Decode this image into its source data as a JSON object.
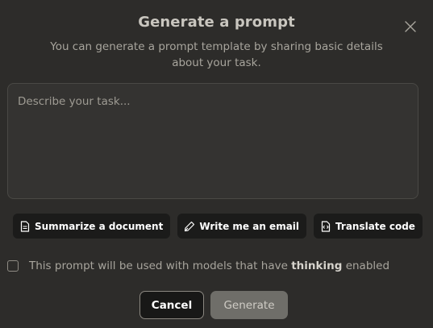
{
  "dialog": {
    "title": "Generate a prompt",
    "subtitle": "You can generate a prompt template by sharing basic details about your task.",
    "close_icon": "close-icon"
  },
  "task_input": {
    "placeholder": "Describe your task...",
    "value": ""
  },
  "suggestions": [
    {
      "label": "Summarize a document",
      "icon": "document-icon"
    },
    {
      "label": "Write me an email",
      "icon": "pen-icon"
    },
    {
      "label": "Translate code",
      "icon": "code-file-icon"
    }
  ],
  "more_icon": "more-icon",
  "thinking": {
    "prefix": "This prompt will be used with models that have",
    "bold": "thinking",
    "suffix": "enabled",
    "checked": false
  },
  "actions": {
    "cancel_label": "Cancel",
    "generate_label": "Generate"
  }
}
